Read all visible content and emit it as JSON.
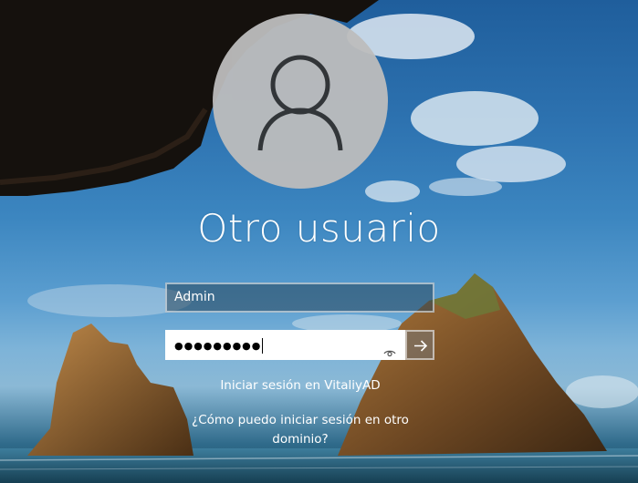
{
  "login": {
    "title": "Otro usuario",
    "username_value": "Admin",
    "password_mask": "●●●●●●●●●",
    "sign_in_to_label": "Iniciar sesión en VitaliyAD",
    "other_domain_link": "¿Cómo puedo iniciar sesión en otro dominio?"
  },
  "icons": {
    "avatar": "user-silhouette-icon",
    "reveal": "eye-icon",
    "submit": "arrow-right-icon"
  },
  "colors": {
    "avatar_bg": "#bdbdbd",
    "field_border": "#ffffff",
    "submit_bg": "#7a7a7a"
  }
}
